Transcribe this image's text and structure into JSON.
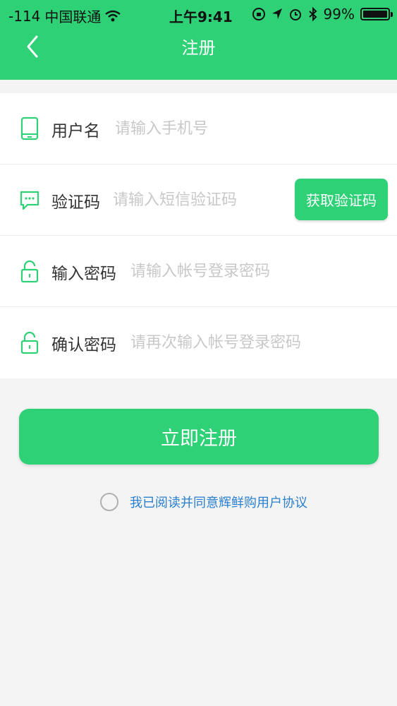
{
  "status_bar": {
    "signal": "-114",
    "carrier": "中国联通",
    "time": "上午9:41",
    "battery_percent": "99%",
    "battery_level": 0.99
  },
  "nav": {
    "title": "注册"
  },
  "form": {
    "username": {
      "label": "用户名",
      "placeholder": "请输入手机号",
      "value": ""
    },
    "sms_code": {
      "label": "验证码",
      "placeholder": "请输入短信验证码",
      "value": "",
      "button": "获取验证码"
    },
    "password": {
      "label": "输入密码",
      "placeholder": "请输入帐号登录密码",
      "value": ""
    },
    "confirm": {
      "label": "确认密码",
      "placeholder": "请再次输入帐号登录密码",
      "value": ""
    }
  },
  "submit_label": "立即注册",
  "agreement": {
    "text": "我已阅读并同意辉鲜购用户协议",
    "checked": false
  },
  "colors": {
    "primary": "#2ed176",
    "link": "#2a7fd0",
    "background": "#f4f4f5"
  },
  "icons": {
    "back": "chevron-left-icon",
    "username": "phone-icon",
    "sms_code": "message-icon",
    "password": "lock-icon",
    "confirm": "lock-icon"
  }
}
